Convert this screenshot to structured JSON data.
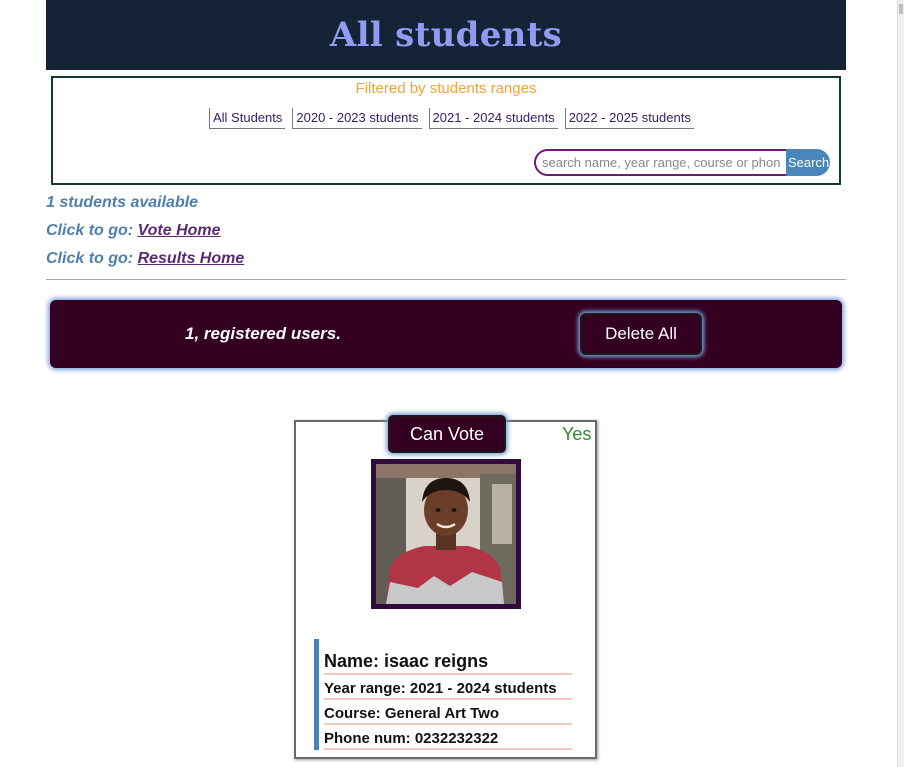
{
  "header": {
    "title": "All students"
  },
  "filter": {
    "title": "Filtered by students ranges",
    "ranges": [
      "All Students",
      "2020 - 2023 students",
      "2021 - 2024 students",
      "2022 - 2025 students"
    ],
    "search_placeholder": "search name, year range, course or phone",
    "search_button": "Search"
  },
  "info": {
    "available": "1 students available",
    "click_to_go": "Click to go:",
    "vote_home": "Vote Home",
    "results_home": "Results Home"
  },
  "banner": {
    "registered": "1, registered users.",
    "delete_all": "Delete All"
  },
  "card": {
    "can_vote_label": "Can Vote",
    "can_vote_value": "Yes",
    "name": "Name: isaac reigns",
    "year_range": "Year range: 2021 - 2024 students",
    "course": "Course: General Art Two",
    "phone": "Phone num: 0232232322"
  },
  "colors": {
    "header_bg": "#142335",
    "header_title": "#8f9cf2",
    "banner_bg": "#330022",
    "info_text": "#4f7fae",
    "link": "#5b2a72",
    "filter_title": "#f1a23a",
    "yes_green": "#2e8b2e",
    "search_button": "#4a86b9"
  }
}
